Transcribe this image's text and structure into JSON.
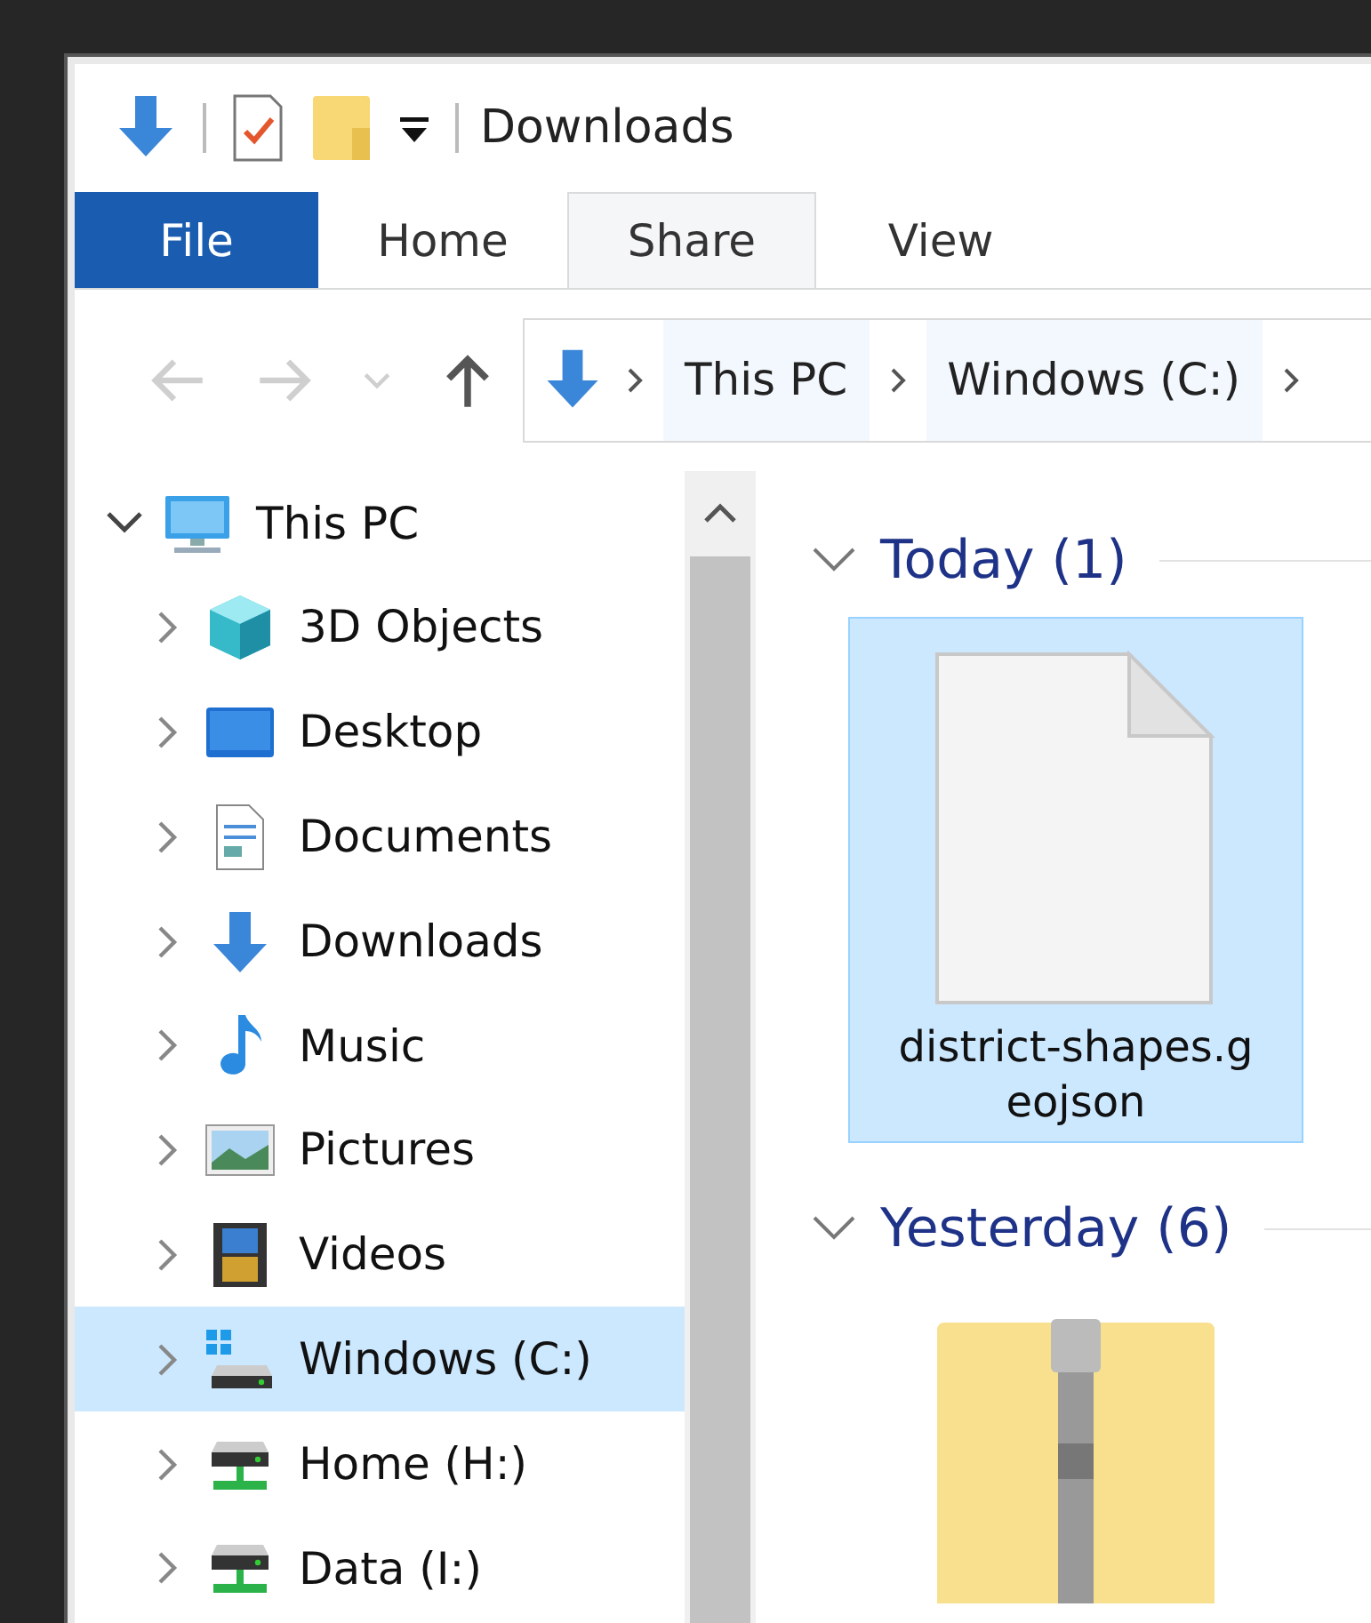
{
  "title_bar": {
    "title": "Downloads"
  },
  "ribbon_tabs": [
    {
      "label": "File",
      "kind": "file",
      "selected": false
    },
    {
      "label": "Home",
      "kind": "tab",
      "selected": false
    },
    {
      "label": "Share",
      "kind": "tab",
      "selected": true
    },
    {
      "label": "View",
      "kind": "tab",
      "selected": false
    }
  ],
  "nav_buttons": [
    {
      "kind": "back",
      "disabled": true
    },
    {
      "kind": "forward",
      "disabled": true
    },
    {
      "kind": "recent",
      "disabled": true
    },
    {
      "kind": "up",
      "disabled": false
    }
  ],
  "address_bar": {
    "segments": [
      "This PC",
      "Windows (C:)"
    ]
  },
  "navigation_pane": {
    "items": [
      {
        "label": "This PC",
        "kind": "pc",
        "expanded": true,
        "selected": false,
        "children": [
          {
            "label": "3D Objects",
            "kind": "cube",
            "expanded": false,
            "selected": false
          },
          {
            "label": "Desktop",
            "kind": "desktop",
            "expanded": false,
            "selected": false
          },
          {
            "label": "Documents",
            "kind": "document",
            "expanded": false,
            "selected": false
          },
          {
            "label": "Downloads",
            "kind": "download",
            "expanded": false,
            "selected": false
          },
          {
            "label": "Music",
            "kind": "music",
            "expanded": false,
            "selected": false
          },
          {
            "label": "Pictures",
            "kind": "pictures",
            "expanded": false,
            "selected": false
          },
          {
            "label": "Videos",
            "kind": "videos",
            "expanded": false,
            "selected": false
          },
          {
            "label": "Windows (C:)",
            "kind": "system-drive",
            "expanded": false,
            "selected": true
          },
          {
            "label": "Home (H:)",
            "kind": "network-drive",
            "expanded": false,
            "selected": false
          },
          {
            "label": "Data (I:)",
            "kind": "network-drive",
            "expanded": false,
            "selected": false
          }
        ]
      }
    ]
  },
  "groups": [
    {
      "label": "Today (1)",
      "expanded": true,
      "files": [
        {
          "name": "district-shapes.geojson",
          "kind": "file",
          "selected": true
        }
      ]
    },
    {
      "label": "Yesterday (6)",
      "expanded": true,
      "files": [
        {
          "kind": "zip",
          "selected": false
        }
      ]
    }
  ]
}
